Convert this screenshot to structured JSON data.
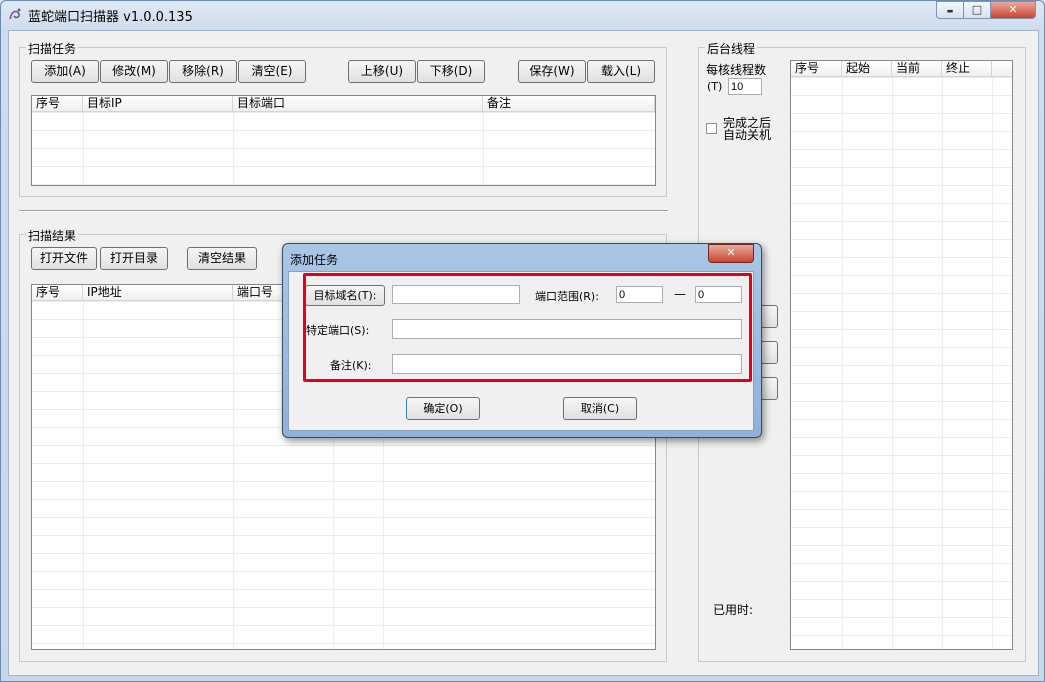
{
  "window": {
    "title": "蓝蛇端口扫描器 v1.0.0.135",
    "minimize": "▬",
    "maximize": "□",
    "close": "✕"
  },
  "scan_tasks": {
    "group_label": "扫描任务",
    "buttons": {
      "add": "添加(A)",
      "edit": "修改(M)",
      "remove": "移除(R)",
      "clear": "清空(E)",
      "move_up": "上移(U)",
      "move_down": "下移(D)",
      "save": "保存(W)",
      "load": "载入(L)"
    },
    "columns": [
      "序号",
      "目标IP",
      "目标端口",
      "备注"
    ]
  },
  "scan_results": {
    "group_label": "扫描结果",
    "buttons": {
      "open_file": "打开文件",
      "open_dir": "打开目录",
      "clear_results": "清空结果"
    },
    "columns": [
      "序号",
      "IP地址",
      "端口号"
    ]
  },
  "threads": {
    "group_label": "后台线程",
    "per_core_label": "每核线程数",
    "per_core_hotkey": "(T)",
    "per_core_value": "10",
    "shutdown_line1": "完成之后",
    "shutdown_line2": "自动关机",
    "shutdown_checked": false,
    "columns": [
      "序号",
      "起始",
      "当前",
      "终止"
    ],
    "elapsed_label": "已用时:"
  },
  "dialog": {
    "title": "添加任务",
    "close": "✕",
    "target_domain_button": "目标域名(T):",
    "target_domain_value": "",
    "port_range_label": "端口范围(R):",
    "port_from": "0",
    "port_dash": "—",
    "port_to": "0",
    "specific_port_label": "特定端口(S):",
    "specific_port_value": "",
    "note_label": "备注(K):",
    "note_value": "",
    "ok": "确定(O)",
    "cancel": "取消(C)"
  },
  "colors": {
    "highlight": "#e2001a",
    "window_frame": "#6d8bb0",
    "dialog_frame": "#8fb1d9"
  }
}
